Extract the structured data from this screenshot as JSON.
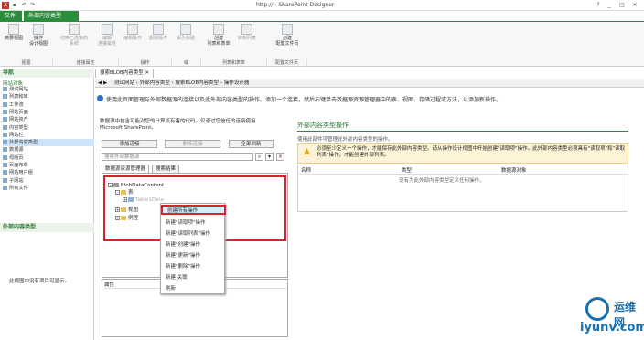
{
  "titlebar": {
    "title": "http://             - SharePoint Designer",
    "icons": [
      "X",
      "?",
      "_",
      "□",
      "✕"
    ]
  },
  "tabs": [
    {
      "label": "文件"
    },
    {
      "label": "外部内容类型"
    }
  ],
  "ribbon": {
    "buttons": [
      {
        "label": "摘要视图",
        "disabled": false
      },
      {
        "label": "操作\n设计视图",
        "disabled": false
      },
      {
        "label": "切换已连接的\n系统",
        "disabled": true
      },
      {
        "label": "编辑\n连接属性",
        "disabled": true
      },
      {
        "label": "编辑操作",
        "disabled": true
      },
      {
        "label": "删除操作",
        "disabled": true
      },
      {
        "label": "设为标题",
        "disabled": true
      },
      {
        "label": "创建\n列表和表单",
        "disabled": false
      },
      {
        "label": "转到列表",
        "disabled": true
      },
      {
        "label": "创建\n配置文件页",
        "disabled": false
      }
    ],
    "groups": [
      "视图",
      "连接属性",
      "操作",
      "域",
      "列表和表单",
      "配置文件页"
    ]
  },
  "nav": {
    "header": "导航",
    "section1": "网站对象",
    "items": [
      "测试网站",
      "列表和库",
      "工作流",
      "网站页面",
      "网站资产",
      "内容类型",
      "网站栏",
      "外部内容类型",
      "数据源",
      "母版页",
      "页面布局",
      "网站用户组",
      "子网站",
      "所有文件"
    ],
    "selected_index": 7,
    "section2": "外部内容类型",
    "empty_text": "此视图中没有项目可显示。"
  },
  "doc_tab": "搜索BLOB内容类型",
  "breadcrumb": {
    "items": [
      "测试网站",
      "外部内容类型",
      "搜索BLOB内容类型",
      "操作设计器"
    ]
  },
  "info_text": "使用此页面管理与外部数据源的连接以及此外部内容类型的操作。添加一个连接，然后右键单击数据源资源管理器中的表、视图、存储过程或方法，以添加新操作。",
  "left_desc": "数据源中包含可能对您的计算机有害的代码。仅通过您信任的连接使用 Microsoft SharePoint。",
  "buttons": {
    "add": "添加连接",
    "remove": "删除连接",
    "refresh": "全部刷新"
  },
  "search_placeholder": "搜索外部数据源",
  "explorer_tabs": [
    "数据源资源管理器",
    "搜索结果"
  ],
  "tree": {
    "root": "BlobDataContent",
    "tables": "表",
    "table_item": "Table1Data",
    "views": "视图",
    "routines": "例程"
  },
  "context_menu": [
    "创建所有操作",
    "新建\"读取项\"操作",
    "新建\"读取列表\"操作",
    "新建\"创建\"操作",
    "新建\"更新\"操作",
    "新建\"删除\"操作",
    "新建 关联",
    "刷新"
  ],
  "props_label": "属性",
  "right_panel": {
    "title": "外部内容类型操作",
    "subtitle": "使用此部件可管理此外部内容类型的操作。",
    "warning": "必须至少定义一个操作，才能保存此外部内容类型。请从操作设计视图中开始创建\"读取项\"操作。此外部内容类型必须具有\"读取项\"和\"读取列表\"操作，才能创建外部列表。",
    "columns": [
      "名称",
      "类型",
      "数据源对象"
    ],
    "empty": "没有为此外部内容类型定义任何操作。"
  },
  "watermark": {
    "cn": "运维网",
    "url": "iyunv.com"
  },
  "colors": {
    "accent": "#2a8d3c",
    "red": "#d9232d"
  }
}
